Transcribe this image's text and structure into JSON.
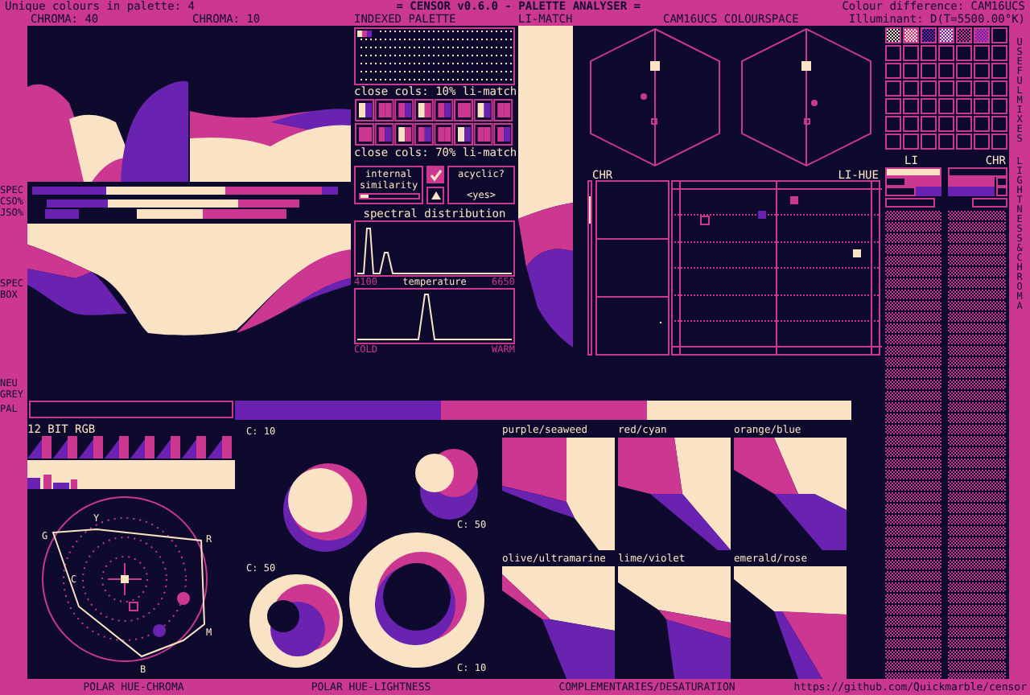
{
  "header": {
    "unique_colours": "Unique colours in palette: 4",
    "title": "= CENSOR v0.6.0 - PALETTE ANALYSER =",
    "colour_difference": "Colour difference: CAM16UCS",
    "illuminant": "Illuminant: D(T=5500.00°K)"
  },
  "palette": [
    {
      "color": "#f9e3c4"
    },
    {
      "color": "#cb3791"
    },
    {
      "color": "#6a22b0"
    },
    {
      "color": "#0e0a2e"
    }
  ],
  "chroma_panels": [
    {
      "label": "CHROMA: 40"
    },
    {
      "label": "CHROMA: 10"
    }
  ],
  "side_labels": {
    "spec": "SPEC",
    "cso": "CSO%",
    "jso": "JSO%",
    "spec_box": "SPEC BOX",
    "neu_grey": "NEU GREY",
    "pal": "PAL"
  },
  "indexed_palette": {
    "title": "INDEXED PALETTE"
  },
  "close_cols": [
    "close cols: 10% li-match",
    "close cols: 70% li-match"
  ],
  "internal_similarity": {
    "label": "internal similarity",
    "checked": true,
    "level": 0.15
  },
  "acyclic": {
    "label": "acyclic?",
    "value": "<yes>"
  },
  "spectral": {
    "title": "spectral distribution",
    "min": "4100",
    "max": "6650"
  },
  "temperature": {
    "title": "temperature",
    "min": "COLD",
    "max": "WARM"
  },
  "li_match": {
    "title": "LI-MATCH"
  },
  "colourspace": {
    "title": "CAM16UCS COLOURSPACE",
    "chr_label": "CHR",
    "li_hue_label": "LI-HUE"
  },
  "mixes": {
    "title": "USEFUL MIXES"
  },
  "lightness_chroma": {
    "title": "LIGHTNESS & CHROMA",
    "li_label": "LI",
    "chr_label": "CHR"
  },
  "rgb12": {
    "title": "12 BIT RGB"
  },
  "polar_hue_chroma": {
    "title": "POLAR HUE-CHROMA",
    "hue_letters": [
      "G",
      "Y",
      "R",
      "C",
      "M",
      "B"
    ]
  },
  "polar_hue_lightness": {
    "title": "POLAR HUE-LIGHTNESS",
    "chroma_labels": [
      "C: 10",
      "C: 50",
      "C: 50",
      "C: 10"
    ]
  },
  "complementaries": {
    "title": "COMPLEMENTARIES/DESATURATION",
    "pairs": [
      "purple/seaweed",
      "red/cyan",
      "orange/blue",
      "olive/ultramarine",
      "lime/violet",
      "emerald/rose"
    ]
  },
  "url": "https://github.com/Quickmarble/censor"
}
